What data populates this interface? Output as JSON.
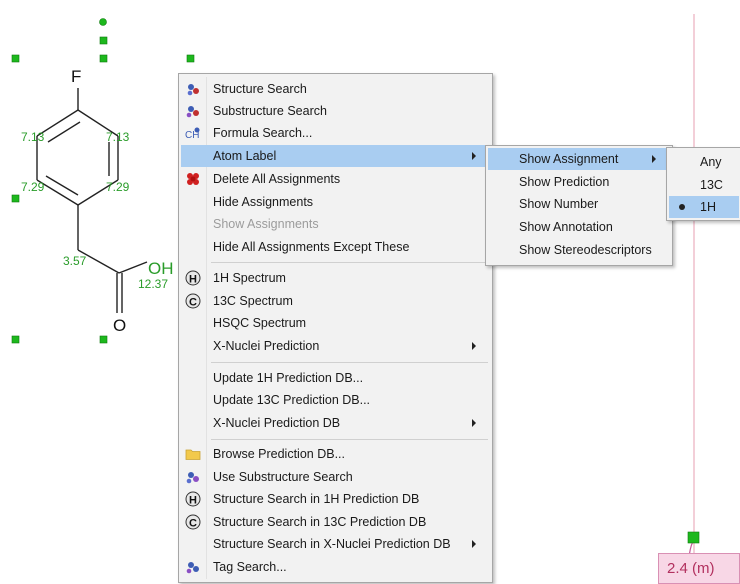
{
  "molecule": {
    "atoms": {
      "fluorine": "F",
      "carboxyl_oh": "OH",
      "carbonyl_o": "O"
    },
    "shifts": {
      "top_left": "7.13",
      "top_right": "7.13",
      "mid_left": "7.29",
      "mid_right": "7.29",
      "ch2": "3.57",
      "oh": "12.37"
    }
  },
  "context_menu": {
    "items": [
      {
        "label": "Structure Search",
        "icon": "structure-search-icon"
      },
      {
        "label": "Substructure Search",
        "icon": "substructure-search-icon"
      },
      {
        "label": "Formula Search...",
        "icon": "formula-search-icon"
      },
      {
        "label": "Atom Label",
        "submenu": true,
        "highlighted": true
      },
      {
        "label": "Delete All Assignments",
        "icon": "delete-assignments-icon"
      },
      {
        "label": "Hide Assignments"
      },
      {
        "label": "Show Assignments",
        "disabled": true
      },
      {
        "label": "Hide All Assignments Except These"
      },
      {
        "label": "1H Spectrum",
        "icon": "h-spectrum-icon"
      },
      {
        "label": "13C Spectrum",
        "icon": "c-spectrum-icon"
      },
      {
        "label": "HSQC Spectrum"
      },
      {
        "label": "X-Nuclei Prediction",
        "submenu": true
      },
      {
        "label": "Update 1H Prediction DB..."
      },
      {
        "label": "Update 13C Prediction DB..."
      },
      {
        "label": "X-Nuclei Prediction DB",
        "submenu": true
      },
      {
        "label": "Browse Prediction DB...",
        "icon": "folder-icon"
      },
      {
        "label": "Use Substructure Search",
        "icon": "substructure-search-icon"
      },
      {
        "label": "Structure Search in 1H Prediction DB",
        "icon": "h-spectrum-icon"
      },
      {
        "label": "Structure Search in 13C Prediction DB",
        "icon": "c-spectrum-icon"
      },
      {
        "label": "Structure Search in X-Nuclei Prediction DB",
        "submenu": true
      },
      {
        "label": "Tag Search...",
        "icon": "tag-search-icon"
      }
    ]
  },
  "atom_label_submenu": {
    "items": [
      {
        "label": "Show Assignment",
        "submenu": true,
        "highlighted": true
      },
      {
        "label": "Show Prediction"
      },
      {
        "label": "Show Number"
      },
      {
        "label": "Show Annotation"
      },
      {
        "label": "Show Stereodescriptors"
      }
    ]
  },
  "show_assignment_submenu": {
    "items": [
      {
        "label": "Any"
      },
      {
        "label": "13C"
      },
      {
        "label": "1H",
        "selected": true,
        "highlighted": true
      }
    ]
  },
  "spectrum": {
    "peak_label": "2.4 (m)",
    "line_color": "#e79fb2",
    "label_bg": "#f8d7e6"
  },
  "colors": {
    "menu_highlight": "#a9cdf1",
    "shift_label": "#2a9c2a",
    "handle": "#1db81d"
  }
}
